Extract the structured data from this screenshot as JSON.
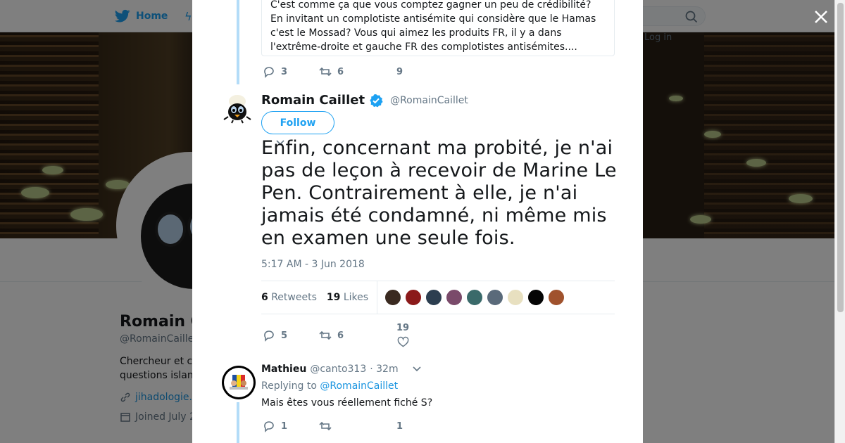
{
  "nav": {
    "home_label": "Home",
    "login_label": "Log in"
  },
  "profile": {
    "name": "Romain C",
    "handle": "@RomainCaille",
    "bio": "Chercheur et c questions islan",
    "link": "jihadologie.",
    "joined": "Joined July 2"
  },
  "quoted_tweet": {
    "lines": [
      "C'est comme ça que vous comptez gagner un peu de crédibilité?",
      "En invitant un complotiste antisémite qui considère que le Hamas",
      "c'est le Mossad? Vous qui aimez les produits FR, il y a dans",
      "l'extrême-droite et gauche FR des complotistes antisémites...."
    ],
    "replies": "3",
    "retweets": "6",
    "likes": "9"
  },
  "main_tweet": {
    "author_name": "Romain Caillet",
    "author_handle": "@RomainCaillet",
    "follow_label": "Follow",
    "text": "Enfin, concernant ma probité, je n'ai pas de leçon à recevoir de Marine Le Pen. Contrairement à elle, je n'ai jamais été condamné, ni même mis en examen une seule fois.",
    "timestamp": "5:17 AM - 3 Jun 2018",
    "retweets_count": "6",
    "retweets_label": "Retweets",
    "likes_count": "19",
    "likes_label": "Likes",
    "likers": [
      "#3a2a20",
      "#8b1a1a",
      "#2c3e50",
      "#7a4a6a",
      "#3a6a6a",
      "#5a6a7a",
      "#e8e0c0",
      "#050505",
      "#a0522d"
    ],
    "replies": "5",
    "retweets": "6",
    "likes": "19"
  },
  "reply_tweet": {
    "author_name": "Mathieu",
    "author_handle": "@canto313",
    "time": "· 32m",
    "replying_prefix": "Replying to",
    "replying_to": "@RomainCaillet",
    "text": "Mais êtes vous réellement fiché S?",
    "replies": "1",
    "likes": "1"
  },
  "colors": {
    "accent": "#1da1f2",
    "thread_line": "#b3dcf8",
    "muted_text": "#657786",
    "verified": "#1da1f2"
  }
}
